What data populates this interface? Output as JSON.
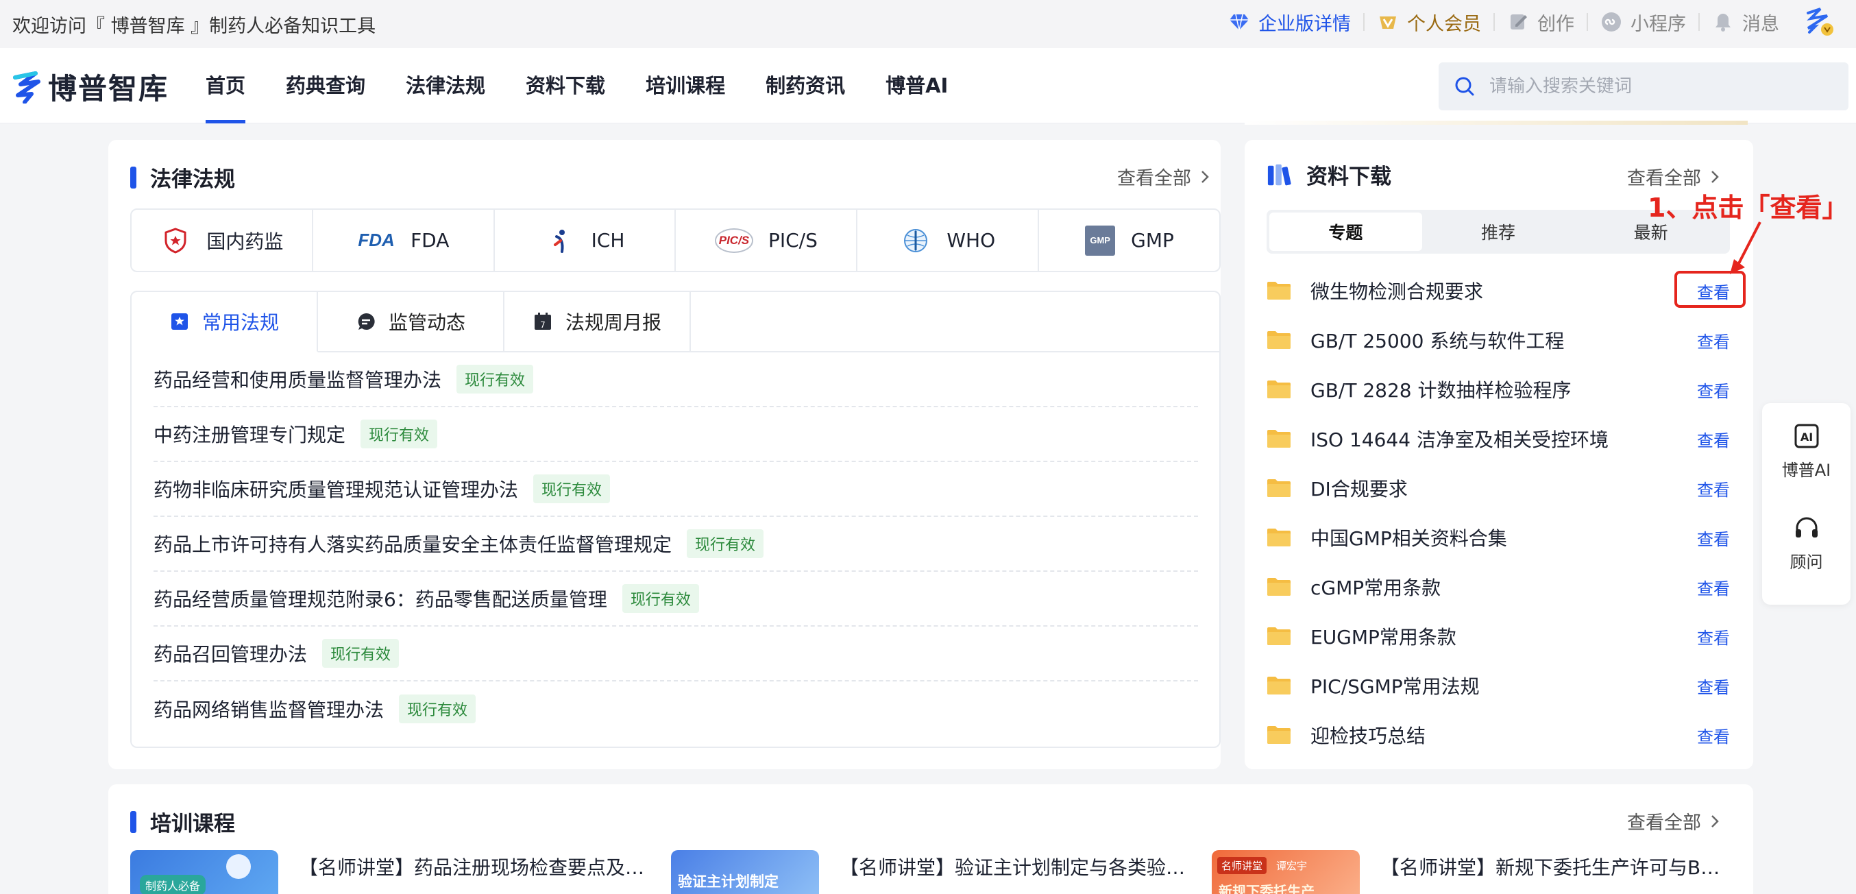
{
  "topbar": {
    "welcome": "欢迎访问『 博普智库 』制药人必备知识工具",
    "links": {
      "enterprise": "企业版详情",
      "member": "个人会员",
      "create": "创作",
      "miniprogram": "小程序",
      "messages": "消息"
    }
  },
  "brand": {
    "name": "博普智库"
  },
  "nav": {
    "items": [
      "首页",
      "药典查询",
      "法律法规",
      "资料下载",
      "培训课程",
      "制药资讯",
      "博普AI"
    ],
    "active_index": 0
  },
  "search": {
    "placeholder": "请输入搜索关键词"
  },
  "laws_section": {
    "title": "法律法规",
    "view_all": "查看全部",
    "orgs": [
      "国内药监",
      "FDA",
      "ICH",
      "PIC/S",
      "WHO",
      "GMP"
    ],
    "org_logo_text": {
      "fda": "FDA",
      "pics": "PIC/S",
      "gmp": "GMP"
    },
    "tabs": [
      "常用法规",
      "监管动态",
      "法规周月报"
    ],
    "active_tab": 0,
    "tab_icon_text": "7",
    "items": [
      {
        "title": "药品经营和使用质量监督管理办法",
        "status": "现行有效"
      },
      {
        "title": "中药注册管理专门规定",
        "status": "现行有效"
      },
      {
        "title": "药物非临床研究质量管理规范认证管理办法",
        "status": "现行有效"
      },
      {
        "title": "药品上市许可持有人落实药品质量安全主体责任监督管理规定",
        "status": "现行有效"
      },
      {
        "title": "药品经营质量管理规范附录6：药品零售配送质量管理",
        "status": "现行有效"
      },
      {
        "title": "药品召回管理办法",
        "status": "现行有效"
      },
      {
        "title": "药品网络销售监督管理办法",
        "status": "现行有效"
      }
    ]
  },
  "downloads_section": {
    "title": "资料下载",
    "view_all": "查看全部",
    "tabs": [
      "专题",
      "推荐",
      "最新"
    ],
    "active_tab": 0,
    "view_label": "查看",
    "items": [
      "微生物检测合规要求",
      "GB/T 25000 系统与软件工程",
      "GB/T 2828 计数抽样检验程序",
      "ISO 14644 洁净室及相关受控环境",
      "DI合规要求",
      "中国GMP相关资料合集",
      "cGMP常用条款",
      "EUGMP常用条款",
      "PIC/SGMP常用法规",
      "迎检技巧总结"
    ]
  },
  "annotation": {
    "text": "1、点击「查看」",
    "color": "#e5251d"
  },
  "float_panel": {
    "ai_label": "博普AI",
    "ai_icon_text": "AI",
    "consult_label": "顾问"
  },
  "courses_section": {
    "title": "培训课程",
    "view_all": "查看全部",
    "items": [
      {
        "title": "【名师讲堂】药品注册现场检查要点及…",
        "thumb_text": "制药人必备"
      },
      {
        "title": "【名师讲堂】验证主计划制定与各类验…",
        "thumb_text": "验证主计划制定"
      },
      {
        "title": "【名师讲堂】新规下委托生产许可与B…",
        "thumb_text": "名师讲堂",
        "thumb_sub": "谭宏宇",
        "thumb_line": "新规下委托生产"
      }
    ]
  },
  "colors": {
    "accent": "#1f54e8",
    "status_green": "#2c8a3c",
    "annotation_red": "#e5251d"
  }
}
